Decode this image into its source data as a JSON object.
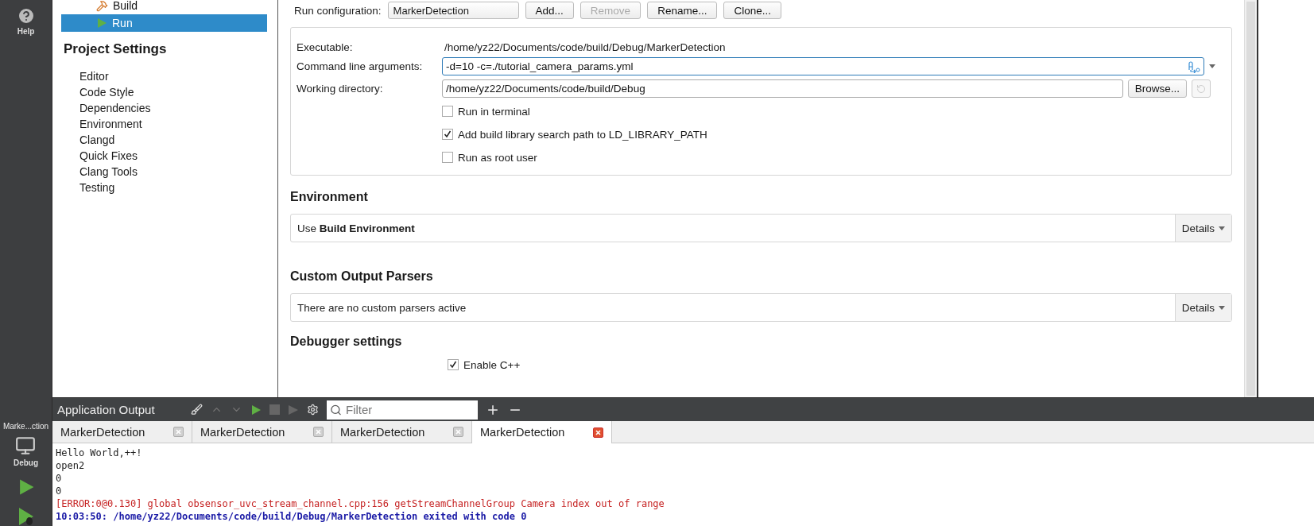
{
  "left_bar": {
    "help": {
      "label": "Help"
    },
    "target": {
      "project": "Marke...ction",
      "config": "Debug"
    }
  },
  "build_run": {
    "items": [
      {
        "kind": "build",
        "label": "Build",
        "selected": false
      },
      {
        "kind": "run",
        "label": "Run",
        "selected": true
      }
    ]
  },
  "project_settings": {
    "title": "Project Settings",
    "items": [
      "Editor",
      "Code Style",
      "Dependencies",
      "Environment",
      "Clangd",
      "Quick Fixes",
      "Clang Tools",
      "Testing"
    ]
  },
  "run_settings": {
    "configuration": {
      "label": "Run configuration:",
      "value": "MarkerDetection",
      "buttons": [
        {
          "label": "Add...",
          "disabled": false
        },
        {
          "label": "Remove",
          "disabled": true
        },
        {
          "label": "Rename...",
          "disabled": false
        },
        {
          "label": "Clone...",
          "disabled": false
        }
      ]
    },
    "executable": {
      "label": "Executable:",
      "value": "/home/yz22/Documents/code/build/Debug/MarkerDetection"
    },
    "arguments": {
      "label": "Command line arguments:",
      "value": "-d=10 -c=./tutorial_camera_params.yml"
    },
    "working_directory": {
      "label": "Working directory:",
      "value": "/home/yz22/Documents/code/build/Debug",
      "button": "Browse..."
    },
    "options": [
      {
        "label": "Run in terminal",
        "checked": false
      },
      {
        "label": "Add build library search path to LD_LIBRARY_PATH",
        "checked": true
      },
      {
        "label": "Run as root user",
        "checked": false
      }
    ]
  },
  "sections": [
    {
      "title": "Environment",
      "summary": "Use **Build Environment**",
      "button": "Details"
    },
    {
      "title": "Custom Output Parsers",
      "summary": "There are no custom parsers active",
      "button": "Details"
    }
  ],
  "debugger": {
    "title": "Debugger settings",
    "options": [
      {
        "label": "Enable C++",
        "checked": true
      }
    ]
  },
  "output": {
    "title": "Application Output",
    "filter": {
      "placeholder": "Filter"
    },
    "tabs": [
      {
        "label": "MarkerDetection",
        "selected": false
      },
      {
        "label": "MarkerDetection",
        "selected": false
      },
      {
        "label": "MarkerDetection",
        "selected": false
      },
      {
        "label": "MarkerDetection",
        "selected": true
      }
    ],
    "lines": [
      {
        "kind": "normal",
        "text": "Hello World,++!"
      },
      {
        "kind": "normal",
        "text": "open2"
      },
      {
        "kind": "normal",
        "text": "0"
      },
      {
        "kind": "normal",
        "text": "0"
      },
      {
        "kind": "error",
        "text": "[ERROR:0@0.130] global obsensor_uvc_stream_channel.cpp:156 getStreamChannelGroup Camera index out of range"
      },
      {
        "kind": "exit",
        "text": "10:03:50: /home/yz22/Documents/code/build/Debug/MarkerDetection exited with code 0"
      }
    ]
  }
}
